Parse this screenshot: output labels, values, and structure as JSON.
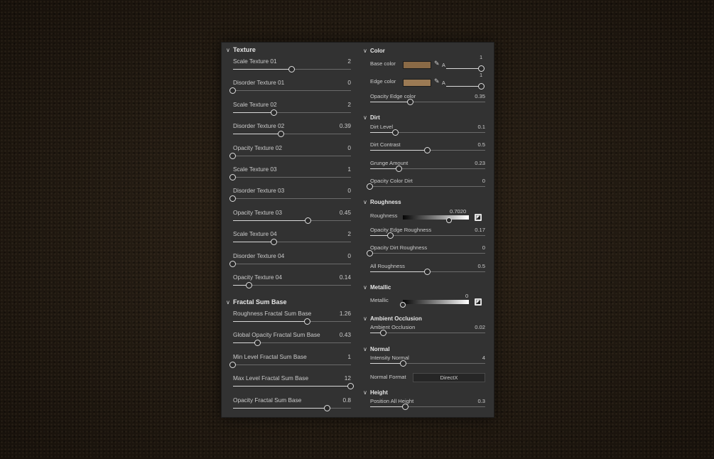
{
  "texture": {
    "title": "Texture",
    "params": [
      {
        "label": "Scale Texture 01",
        "value": "2",
        "pct": 50
      },
      {
        "label": "Disorder Texture 01",
        "value": "0",
        "pct": 0
      },
      {
        "label": "Scale Texture 02",
        "value": "2",
        "pct": 35
      },
      {
        "label": "Disorder Texture 02",
        "value": "0.39",
        "pct": 41
      },
      {
        "label": "Opacity Texture 02",
        "value": "0",
        "pct": 0
      },
      {
        "label": "Scale Texture 03",
        "value": "1",
        "pct": 0
      },
      {
        "label": "Disorder Texture 03",
        "value": "0",
        "pct": 0
      },
      {
        "label": "Opacity Texture 03",
        "value": "0.45",
        "pct": 64
      },
      {
        "label": "Scale Texture 04",
        "value": "2",
        "pct": 35
      },
      {
        "label": "Disorder Texture 04",
        "value": "0",
        "pct": 0
      },
      {
        "label": "Opacity Texture 04",
        "value": "0.14",
        "pct": 14
      }
    ]
  },
  "fractal": {
    "title": "Fractal Sum Base",
    "params": [
      {
        "label": "Roughness Fractal Sum Base",
        "value": "1.26",
        "pct": 63
      },
      {
        "label": "Global Opacity Fractal Sum Base",
        "value": "0.43",
        "pct": 21
      },
      {
        "label": "Min Level Fractal Sum Base",
        "value": "1",
        "pct": 0
      },
      {
        "label": "Max Level Fractal Sum Base",
        "value": "12",
        "pct": 100
      },
      {
        "label": "Opacity Fractal Sum Base",
        "value": "0.8",
        "pct": 80
      }
    ]
  },
  "color": {
    "title": "Color",
    "base": {
      "label": "Base color",
      "swatch": "#8a6a46",
      "alpha_label": "A",
      "alpha_value": "1"
    },
    "edge": {
      "label": "Edge color",
      "swatch": "#9b7a54",
      "alpha_label": "A",
      "alpha_value": "1"
    },
    "opacity_edge": {
      "label": "Opacity Edge color",
      "value": "0.35",
      "pct": 35
    }
  },
  "dirt": {
    "title": "Dirt",
    "params": [
      {
        "label": "Dirt Level",
        "value": "0.1",
        "pct": 22
      },
      {
        "label": "Dirt Contrast",
        "value": "0.5",
        "pct": 50
      },
      {
        "label": "Grunge Amount",
        "value": "0.23",
        "pct": 25
      },
      {
        "label": "Opacity Color Dirt",
        "value": "0",
        "pct": 0
      }
    ]
  },
  "roughness": {
    "title": "Roughness",
    "main": {
      "label": "Roughness",
      "value": "0.7020",
      "pct": 70
    },
    "params": [
      {
        "label": "Opacity Edge Roughness",
        "value": "0.17",
        "pct": 18
      },
      {
        "label": "Opacity Dirt Roughness",
        "value": "0",
        "pct": 0
      },
      {
        "label": "All Roughness",
        "value": "0.5",
        "pct": 50
      }
    ]
  },
  "metallic": {
    "title": "Metallic",
    "main": {
      "label": "Metallic",
      "value": "0",
      "pct": 0
    }
  },
  "ao": {
    "title": "Ambient Occlusion",
    "params": [
      {
        "label": "Ambient Occlusion",
        "value": "0.02",
        "pct": 12
      }
    ]
  },
  "normal": {
    "title": "Normal",
    "params": [
      {
        "label": "Intensity Normal",
        "value": "4",
        "pct": 29
      }
    ],
    "format_label": "Normal Format",
    "format_value": "DirectX"
  },
  "height": {
    "title": "Height",
    "params": [
      {
        "label": "Position All Height",
        "value": "0.3",
        "pct": 31
      }
    ]
  },
  "icons": {
    "collapse": "chevron-down-icon",
    "dropper": "eyedropper-icon",
    "gradient_toggle": "gradient-toggle-icon"
  }
}
